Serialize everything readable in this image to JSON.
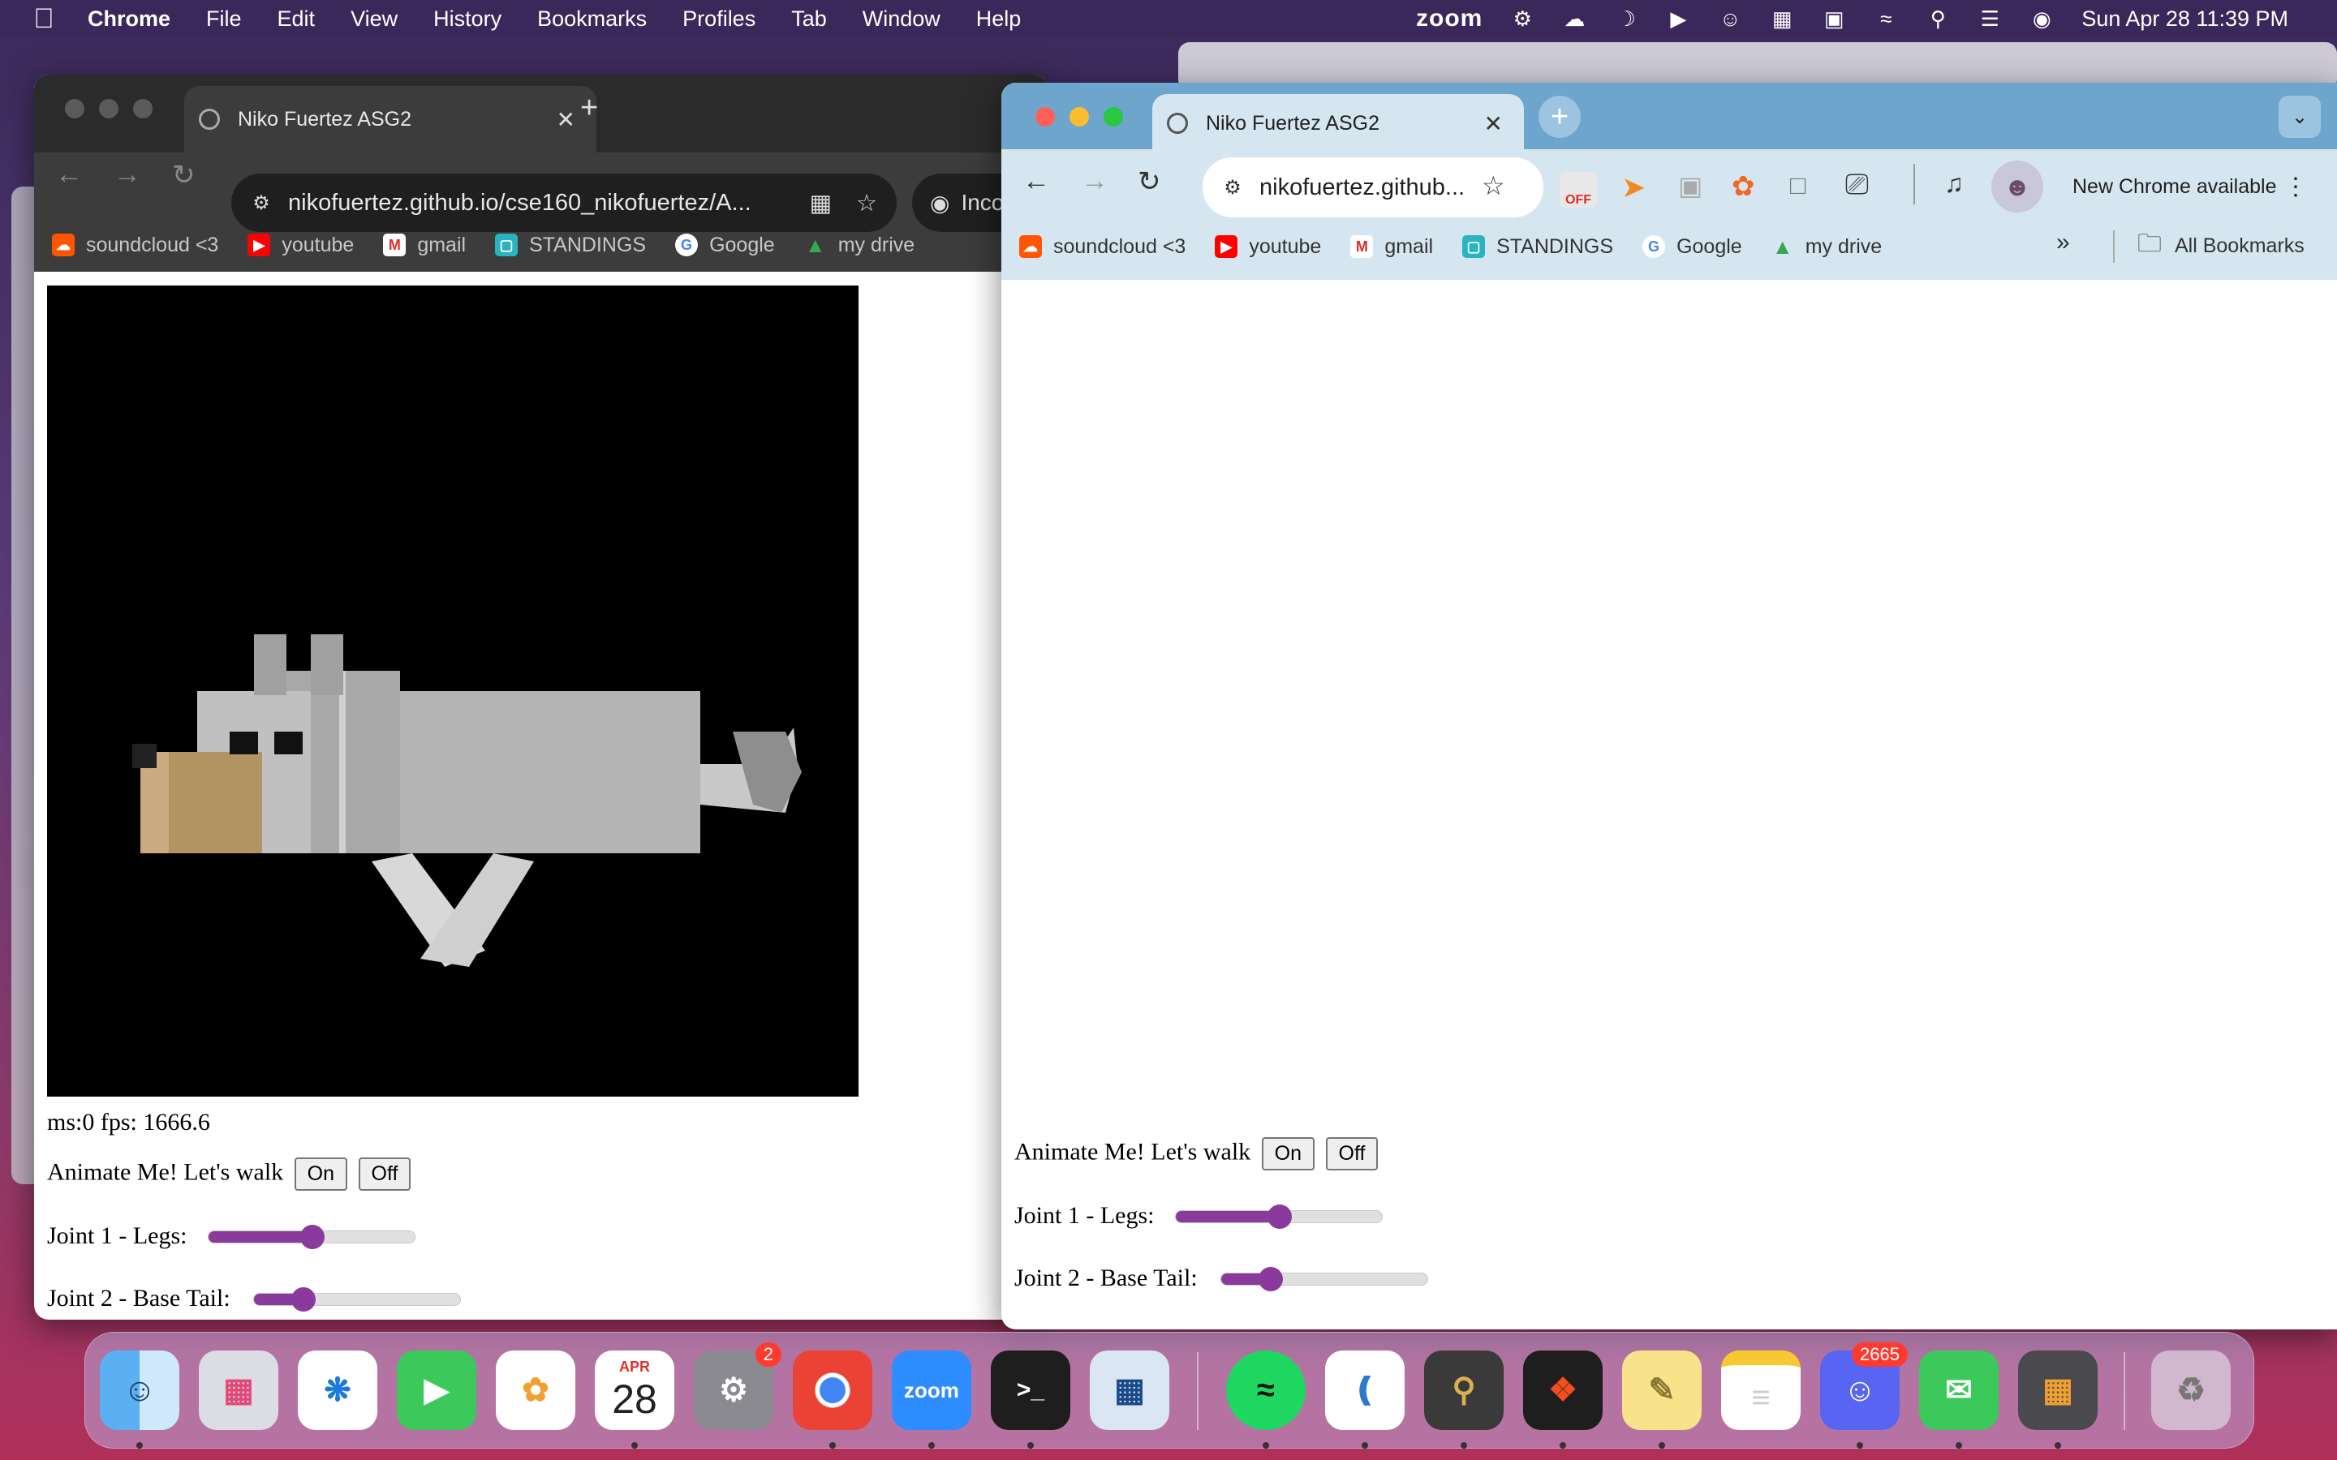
{
  "menubar": {
    "app": "Chrome",
    "items": [
      "File",
      "Edit",
      "View",
      "History",
      "Bookmarks",
      "Profiles",
      "Tab",
      "Window",
      "Help"
    ],
    "zoom_label": "zoom",
    "datetime": "Sun Apr 28  11:39 PM"
  },
  "left_window": {
    "tab_title": "Niko Fuertez ASG2",
    "url": "nikofuertez.github.io/cse160_nikofuertez/A...",
    "incognito_label": "Inco",
    "bookmarks": [
      "soundcloud <3",
      "youtube",
      "gmail",
      "STANDINGS",
      "Google",
      "my drive"
    ],
    "fps_text": "ms:0 fps: 1666.6",
    "animate_label": "Animate Me! Let's walk",
    "on_label": "On",
    "off_label": "Off",
    "joint1_label": "Joint 1 - Legs:",
    "joint1_value": 0.5,
    "joint2_label": "Joint 2 - Base Tail:",
    "joint2_value": 0.24
  },
  "right_window": {
    "tab_title": "Niko Fuertez ASG2",
    "url": "nikofuertez.github...",
    "new_chrome_label": "New Chrome available",
    "bookmarks": [
      "soundcloud <3",
      "youtube",
      "gmail",
      "STANDINGS",
      "Google",
      "my drive"
    ],
    "all_bookmarks_label": "All Bookmarks",
    "animate_label": "Animate Me! Let's walk",
    "on_label": "On",
    "off_label": "Off",
    "joint1_label": "Joint 1 - Legs:",
    "joint1_value": 0.5,
    "joint2_label": "Joint 2 - Base Tail:",
    "joint2_value": 0.24
  },
  "dock": {
    "apps": [
      "Finder",
      "Launchpad",
      "Safari",
      "FaceTime",
      "Photos",
      "Calendar",
      "System Settings",
      "Chrome",
      "Zoom",
      "Terminal",
      "VirtualBox",
      "Spotify",
      "VS Code",
      "Keychain Access",
      "Figma",
      "Stickies",
      "Notes",
      "Discord",
      "Messages",
      "Calculator",
      "Trash"
    ],
    "calendar_month": "APR",
    "calendar_day": "28",
    "settings_badge": "2",
    "discord_badge": "2665",
    "zoom_label": "zoom"
  },
  "colors": {
    "slider_accent": "#8a3a9c",
    "left_chrome_bg": "#2b2b2b",
    "right_tab_bg": "#6ea5cc",
    "right_toolbar_bg": "#d6e6f0"
  }
}
